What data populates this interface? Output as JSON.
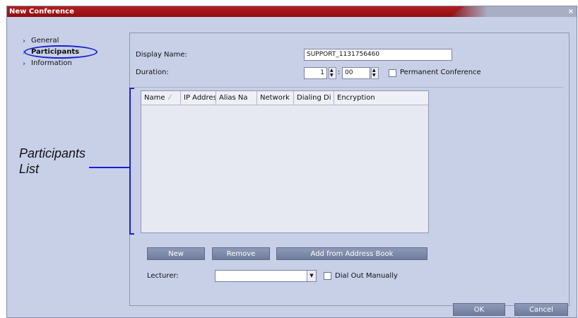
{
  "window": {
    "title": "New Conference",
    "close_label": "×"
  },
  "nav": {
    "items": [
      {
        "label": "General",
        "icon": "chevron-right-icon"
      },
      {
        "label": "Participants",
        "icon": "chevron-right-icon"
      },
      {
        "label": "Information",
        "icon": "chevron-right-icon"
      }
    ]
  },
  "form": {
    "display_name_label": "Display Name:",
    "display_name_value": "SUPPORT_1131756460",
    "duration_label": "Duration:",
    "duration_hours": "1",
    "duration_separator": ":",
    "duration_minutes": "00",
    "permanent_conference_label": "Permanent Conference"
  },
  "table": {
    "columns": [
      "Name",
      "IP Addres",
      "Alias Na",
      "Network",
      "Dialing Di",
      "Encryption"
    ],
    "rows": []
  },
  "buttons": {
    "new": "New",
    "remove": "Remove",
    "add_from_address_book": "Add from Address Book",
    "ok": "OK",
    "cancel": "Cancel"
  },
  "lecturer": {
    "label": "Lecturer:",
    "value": "",
    "dial_out_manually_label": "Dial Out Manually"
  },
  "callout": {
    "line1": "Participants",
    "line2": "List"
  },
  "colors": {
    "accent": "#1b1fd0",
    "titlebar": "#b51e1e",
    "panel": "#c8d0e8"
  }
}
